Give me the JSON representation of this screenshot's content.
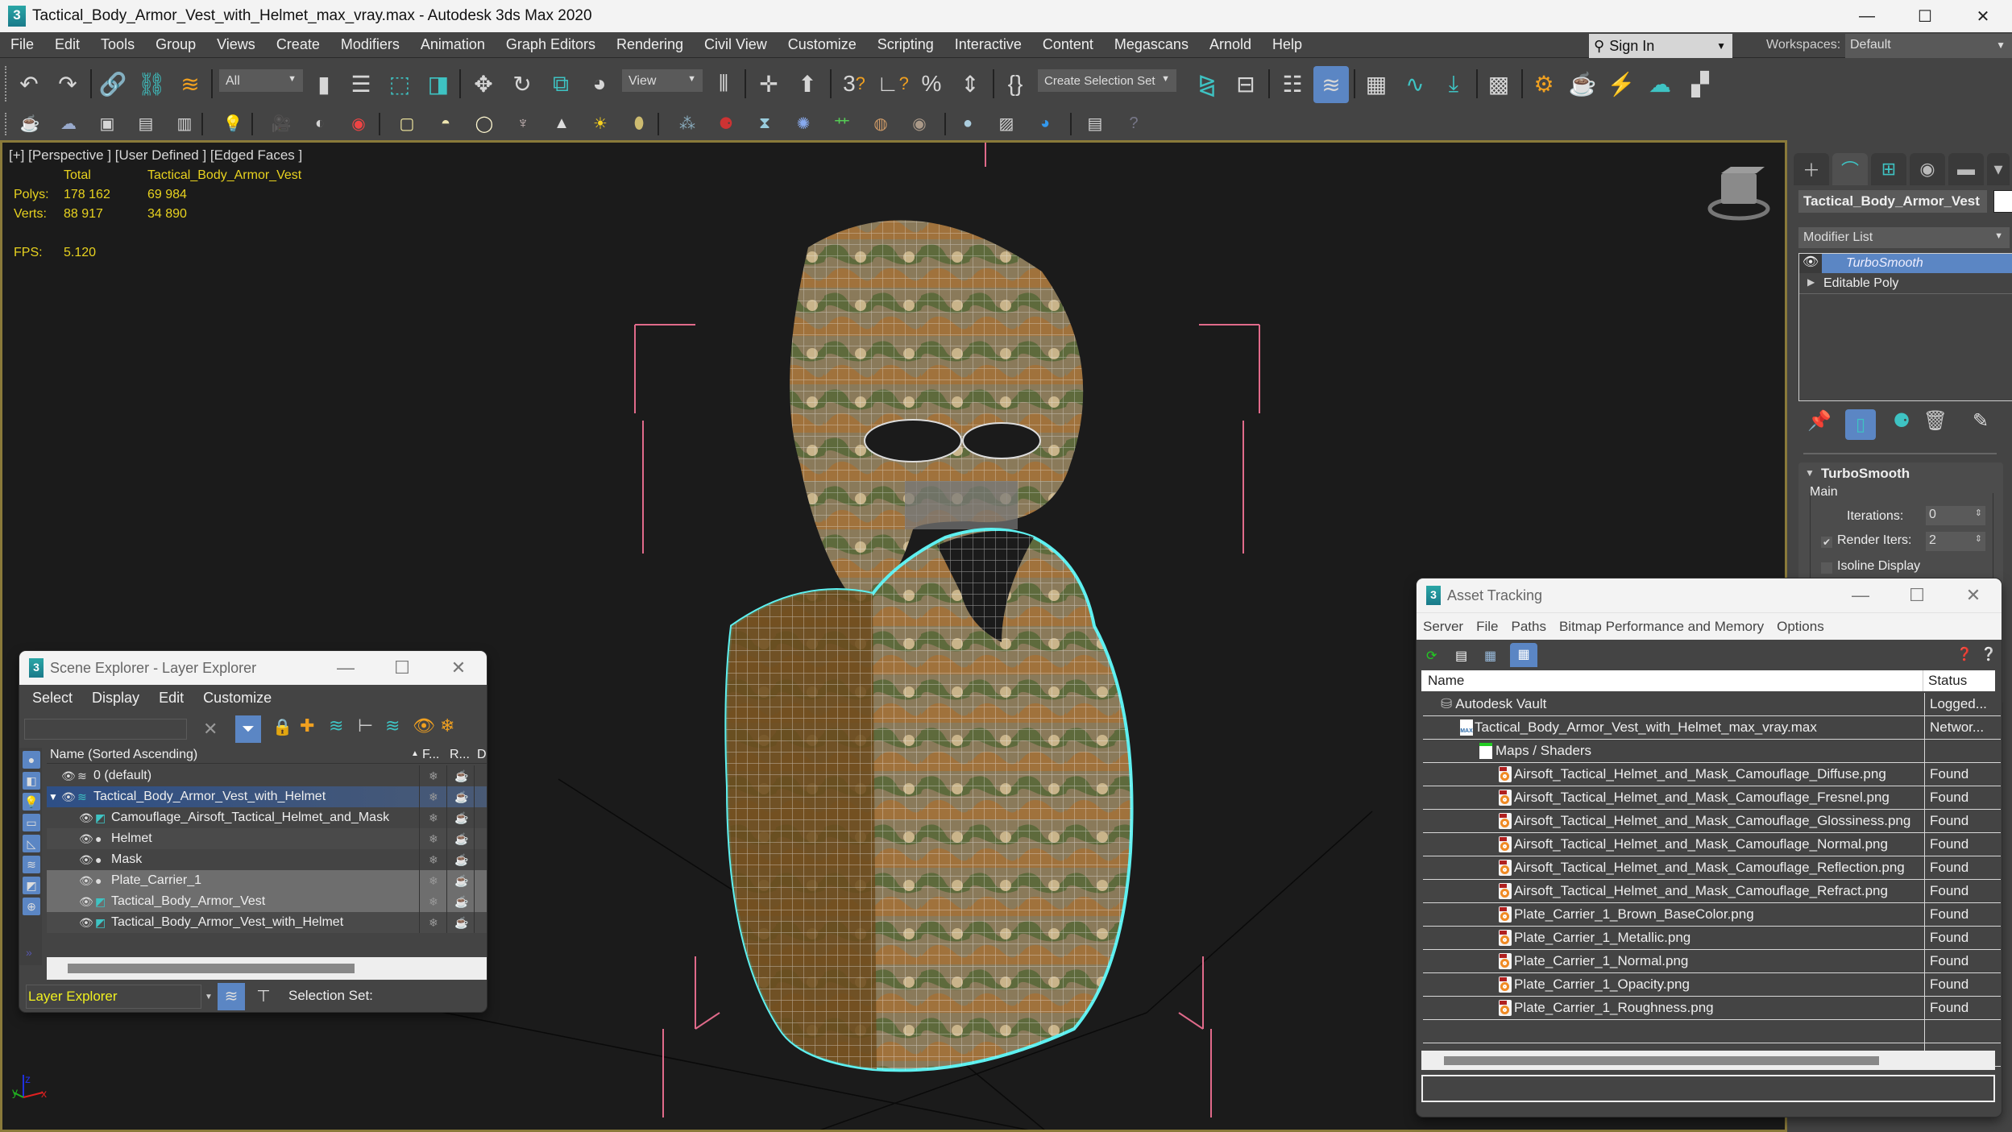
{
  "window": {
    "title": "Tactical_Body_Armor_Vest_with_Helmet_max_vray.max - Autodesk 3ds Max 2020",
    "app_icon_text": "3",
    "minimize": "—",
    "maximize": "☐",
    "close": "✕"
  },
  "menubar": {
    "items": [
      "File",
      "Edit",
      "Tools",
      "Group",
      "Views",
      "Create",
      "Modifiers",
      "Animation",
      "Graph Editors",
      "Rendering",
      "Civil View",
      "Customize",
      "Scripting",
      "Interactive",
      "Content",
      "Megascans",
      "Arnold",
      "Help"
    ],
    "sign_in": "Sign In",
    "workspaces_label": "Workspaces:",
    "workspace_value": "Default"
  },
  "toolbar": {
    "selection_filter": "All",
    "reference_coord": "View",
    "create_selection_set": "Create Selection Set"
  },
  "viewport": {
    "label": "[+] [Perspective ] [User Defined ] [Edged Faces ]",
    "stats": {
      "col_total": "Total",
      "col_object": "Tactical_Body_Armor_Vest",
      "polys_label": "Polys:",
      "polys_total": "178 162",
      "polys_object": "69 984",
      "verts_label": "Verts:",
      "verts_total": "88 917",
      "verts_object": "34 890",
      "fps_label": "FPS:",
      "fps_value": "5.120"
    },
    "axis": {
      "x": "x",
      "y": "y",
      "z": "z"
    }
  },
  "command_panel": {
    "object_name": "Tactical_Body_Armor_Vest",
    "object_color": "#ffffff",
    "modifier_list_label": "Modifier List",
    "stack": [
      {
        "label": "TurboSmooth",
        "selected": true
      },
      {
        "label": "Editable Poly",
        "selected": false
      }
    ],
    "rollout": {
      "title": "TurboSmooth",
      "group": "Main",
      "iterations_label": "Iterations:",
      "iterations_value": "0",
      "render_iters_label": "Render Iters:",
      "render_iters_value": "2",
      "render_iters_checked": true,
      "isoline_label": "Isoline Display"
    }
  },
  "scene_explorer": {
    "title": "Scene Explorer - Layer Explorer",
    "menu": [
      "Select",
      "Display",
      "Edit",
      "Customize"
    ],
    "search_value": "",
    "columns": {
      "name": "Name (Sorted Ascending)",
      "frozen": "F...",
      "render": "R...",
      "display": "Displ"
    },
    "rows": [
      {
        "name": "0 (default)",
        "type": "layer",
        "level": 0,
        "selected": false
      },
      {
        "name": "Tactical_Body_Armor_Vest_with_Helmet",
        "type": "layer-active",
        "level": 0,
        "selected": true,
        "expanded": true
      },
      {
        "name": "Camouflage_Airsoft_Tactical_Helmet_and_Mask",
        "type": "group",
        "level": 1,
        "selected": false
      },
      {
        "name": "Helmet",
        "type": "object",
        "level": 1,
        "selected": false
      },
      {
        "name": "Mask",
        "type": "object",
        "level": 1,
        "selected": false
      },
      {
        "name": "Plate_Carrier_1",
        "type": "object",
        "level": 1,
        "selected": false,
        "highlight": true
      },
      {
        "name": "Tactical_Body_Armor_Vest",
        "type": "group",
        "level": 1,
        "selected": false,
        "highlight": true
      },
      {
        "name": "Tactical_Body_Armor_Vest_with_Helmet",
        "type": "group",
        "level": 1,
        "selected": false
      }
    ],
    "footer": {
      "explorer_type": "Layer Explorer",
      "selection_set_label": "Selection Set:"
    }
  },
  "asset_tracking": {
    "title": "Asset Tracking",
    "menu": [
      "Server",
      "File",
      "Paths",
      "Bitmap Performance and Memory",
      "Options"
    ],
    "columns": {
      "name": "Name",
      "status": "Status"
    },
    "rows": [
      {
        "name": "Autodesk Vault",
        "status": "Logged...",
        "level": 0,
        "icon": "vault"
      },
      {
        "name": "Tactical_Body_Armor_Vest_with_Helmet_max_vray.max",
        "status": "Networ...",
        "level": 1,
        "icon": "max-file"
      },
      {
        "name": "Maps / Shaders",
        "status": "",
        "level": 2,
        "icon": "maps-folder"
      },
      {
        "name": "Airsoft_Tactical_Helmet_and_Mask_Camouflage_Diffuse.png",
        "status": "Found",
        "level": 3,
        "icon": "png"
      },
      {
        "name": "Airsoft_Tactical_Helmet_and_Mask_Camouflage_Fresnel.png",
        "status": "Found",
        "level": 3,
        "icon": "png"
      },
      {
        "name": "Airsoft_Tactical_Helmet_and_Mask_Camouflage_Glossiness.png",
        "status": "Found",
        "level": 3,
        "icon": "png"
      },
      {
        "name": "Airsoft_Tactical_Helmet_and_Mask_Camouflage_Normal.png",
        "status": "Found",
        "level": 3,
        "icon": "png"
      },
      {
        "name": "Airsoft_Tactical_Helmet_and_Mask_Camouflage_Reflection.png",
        "status": "Found",
        "level": 3,
        "icon": "png"
      },
      {
        "name": "Airsoft_Tactical_Helmet_and_Mask_Camouflage_Refract.png",
        "status": "Found",
        "level": 3,
        "icon": "png"
      },
      {
        "name": "Plate_Carrier_1_Brown_BaseColor.png",
        "status": "Found",
        "level": 3,
        "icon": "png"
      },
      {
        "name": "Plate_Carrier_1_Metallic.png",
        "status": "Found",
        "level": 3,
        "icon": "png"
      },
      {
        "name": "Plate_Carrier_1_Normal.png",
        "status": "Found",
        "level": 3,
        "icon": "png"
      },
      {
        "name": "Plate_Carrier_1_Opacity.png",
        "status": "Found",
        "level": 3,
        "icon": "png"
      },
      {
        "name": "Plate_Carrier_1_Roughness.png",
        "status": "Found",
        "level": 3,
        "icon": "png"
      }
    ],
    "path_field_value": ""
  },
  "colors": {
    "accent_blue": "#5b86c4",
    "stats_yellow": "#e8d21f",
    "teal": "#3ec3c3",
    "viewport_border": "#8a7a3a"
  }
}
